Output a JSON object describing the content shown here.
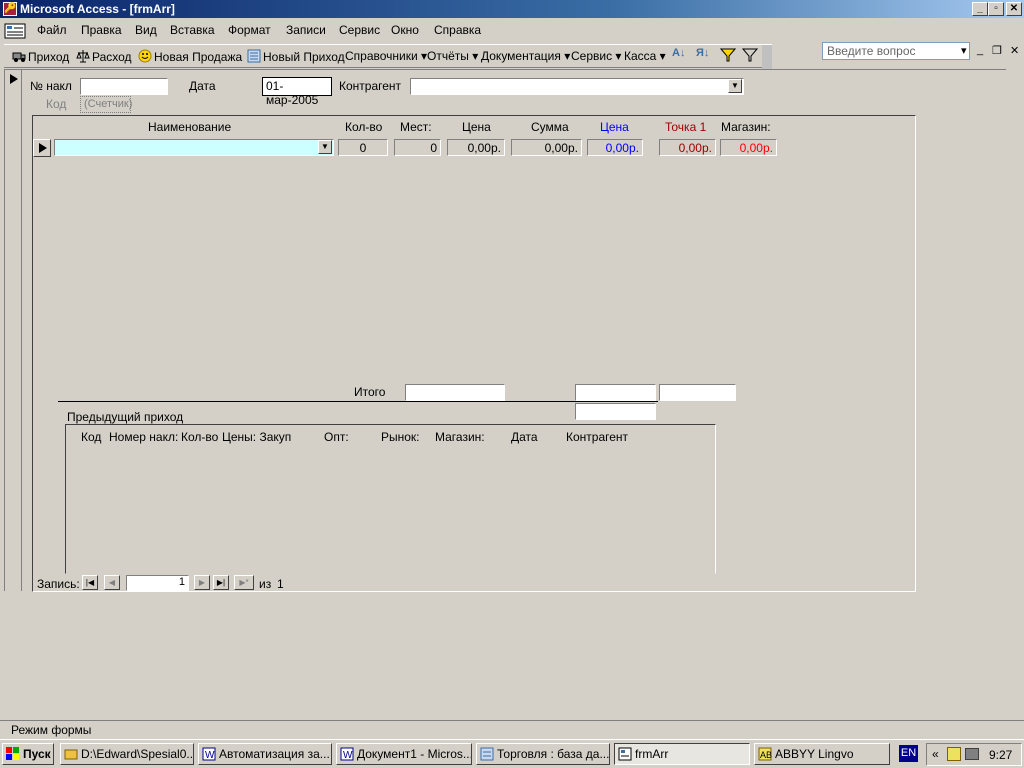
{
  "window": {
    "title": "Microsoft Access - [frmArr]",
    "min": "_",
    "max": "▫",
    "close": "✕"
  },
  "menu": {
    "items": [
      "Файл",
      "Правка",
      "Вид",
      "Вставка",
      "Формат",
      "Записи",
      "Сервис",
      "Окно",
      "Справка"
    ],
    "ask_placeholder": "Введите вопрос"
  },
  "toolbar": {
    "items": [
      "Приход",
      "Расход",
      "Новая Продажа",
      "Новый Приход",
      "Справочники",
      "Отчёты",
      "Документация",
      "Сервис",
      "Касса"
    ]
  },
  "header": {
    "nakl_label": "№ накл",
    "nakl_value": "",
    "date_label": "Дата",
    "date_value": "01-мар-2005",
    "kontragent_label": "Контрагент",
    "kontragent_value": "",
    "kod_label": "Код",
    "kod_value": "(Счетчик)"
  },
  "grid": {
    "columns": [
      "Наименование",
      "Кол-во",
      "Мест:",
      "Цена",
      "Сумма",
      "Цена",
      "Точка 1",
      "Магазин:"
    ],
    "row": {
      "name": "",
      "qty": "0",
      "places": "0",
      "price": "0,00р.",
      "sum": "0,00р.",
      "price2": "0,00р.",
      "point1": "0,00р.",
      "shop": "0,00р."
    }
  },
  "totals": {
    "label": "Итого"
  },
  "previous": {
    "label": "Предыдущий приход",
    "columns": [
      "Код",
      "Номер накл:",
      "Кол-во",
      "Цены: Закуп",
      "Опт:",
      "Рынок:",
      "Магазин:",
      "Дата",
      "Контрагент"
    ]
  },
  "navigation": {
    "label": "Запись:",
    "current": "1",
    "of_label": "из",
    "total": "1"
  },
  "status": {
    "text": "Режим формы"
  },
  "taskbar": {
    "start": "Пуск",
    "tasks": [
      "D:\\Edward\\Spesial0...",
      "Автоматизация за...",
      "Документ1 - Micros...",
      "Торговля : база да...",
      "frmArr",
      "ABBYY Lingvo"
    ],
    "lang": "EN",
    "clock": "9:27"
  },
  "colors": {
    "title_start": "#0a246a",
    "accent_blue": "#0000ff",
    "accent_red": "#ff0000",
    "accent_darkred": "#a00000",
    "combo_bg": "#ccffff"
  }
}
